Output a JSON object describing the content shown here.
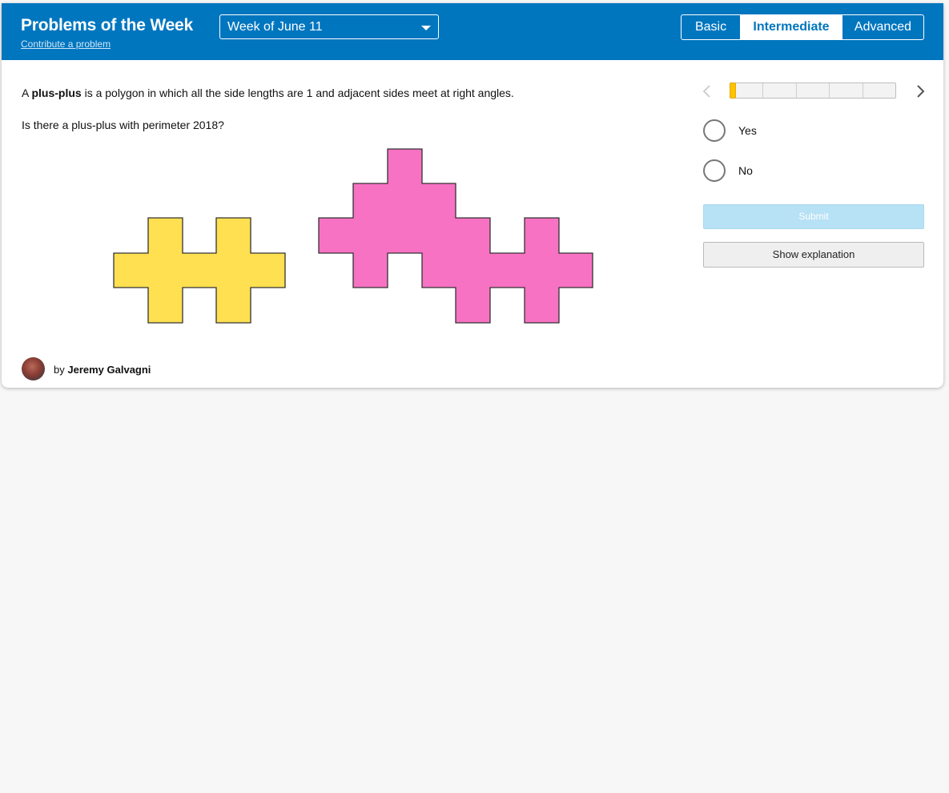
{
  "header": {
    "title": "Problems of the Week",
    "contribute_link": "Contribute a problem",
    "week_select": {
      "selected": "Week of June 11"
    },
    "levels": [
      {
        "label": "Basic",
        "active": false
      },
      {
        "label": "Intermediate",
        "active": true
      },
      {
        "label": "Advanced",
        "active": false
      }
    ]
  },
  "problem": {
    "intro_article": "A",
    "term": "plus-plus",
    "definition": "is a polygon in which all the side lengths are 1 and adjacent sides meet at right angles.",
    "question": "Is there a plus-plus with perimeter 2018?",
    "shape_colors": {
      "yellow": "#ffe050",
      "pink": "#f772c3",
      "outline": "#333333"
    }
  },
  "sidebar": {
    "progress": {
      "current": 1,
      "total": 5
    },
    "choices": [
      {
        "label": "Yes"
      },
      {
        "label": "No"
      }
    ],
    "submit_label": "Submit",
    "explanation_label": "Show explanation"
  },
  "author": {
    "prefix": "by",
    "name": "Jeremy Galvagni"
  },
  "colors": {
    "header_bg": "#0076bf",
    "progress_fill": "#fdc200",
    "submit_disabled": "#b7e1f5"
  }
}
